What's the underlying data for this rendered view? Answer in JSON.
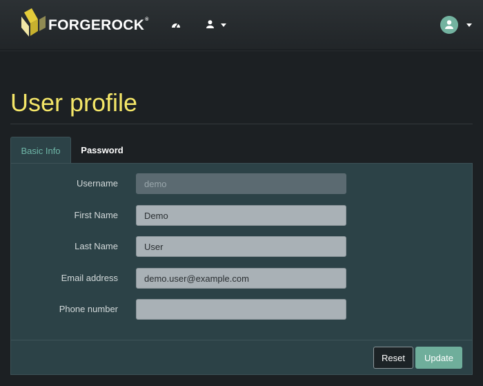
{
  "navbar": {
    "brand": "FORGEROCK",
    "brand_mark": "®",
    "icons": [
      "dashboard-icon",
      "user-icon",
      "chevron-down-icon",
      "avatar-user-icon"
    ]
  },
  "page": {
    "title": "User profile"
  },
  "tabs": [
    {
      "label": "Basic Info",
      "active": true
    },
    {
      "label": "Password",
      "active": false
    }
  ],
  "form": {
    "fields": [
      {
        "label": "Username",
        "value": "demo",
        "readonly": true
      },
      {
        "label": "First Name",
        "value": "Demo"
      },
      {
        "label": "Last Name",
        "value": "User"
      },
      {
        "label": "Email address",
        "value": "demo.user@example.com"
      },
      {
        "label": "Phone number",
        "value": ""
      }
    ],
    "reset_label": "Reset",
    "update_label": "Update"
  },
  "colors": {
    "title": "#f4e668",
    "accent": "#6fb7a8",
    "panel": "#2c4247",
    "background": "#1c2023"
  }
}
